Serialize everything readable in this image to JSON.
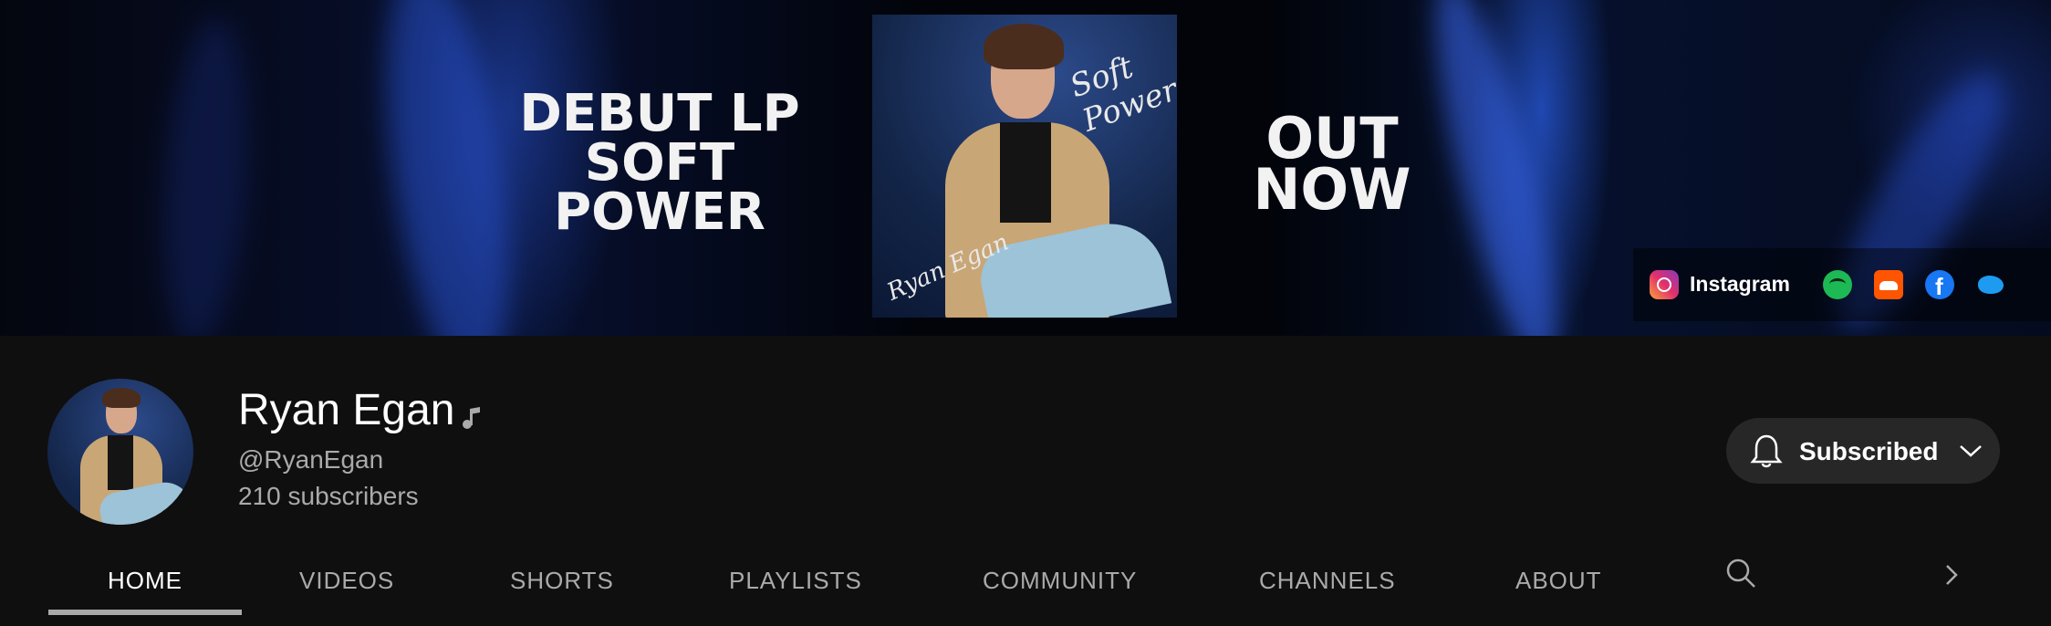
{
  "banner": {
    "promo_left": "DEBUT LP SOFT POWER",
    "promo_right": "OUT NOW",
    "album_signature_top": "Soft Power",
    "album_signature_bottom": "Ryan Egan",
    "links": {
      "instagram_label": "Instagram",
      "icons": [
        "instagram-icon",
        "spotify-icon",
        "soundcloud-icon",
        "facebook-icon",
        "twitter-icon"
      ]
    }
  },
  "channel": {
    "name": "Ryan Egan",
    "handle": "@RyanEgan",
    "subscribers": "210 subscribers",
    "subscribe_button": "Subscribed"
  },
  "tabs": [
    {
      "label": "HOME",
      "active": true
    },
    {
      "label": "VIDEOS"
    },
    {
      "label": "SHORTS"
    },
    {
      "label": "PLAYLISTS"
    },
    {
      "label": "COMMUNITY"
    },
    {
      "label": "CHANNELS"
    },
    {
      "label": "ABOUT"
    }
  ],
  "colors": {
    "background": "#0f0f0f",
    "secondary_text": "#aaaaaa",
    "button_bg": "#272727"
  }
}
